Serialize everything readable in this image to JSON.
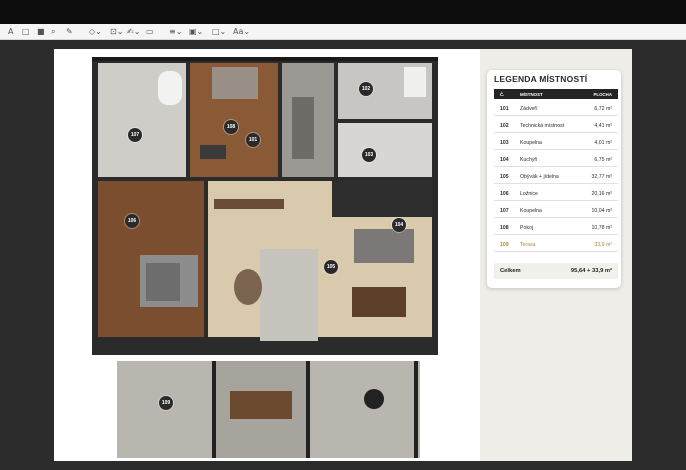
{
  "toolbar": {
    "items": [
      {
        "icon": "text-tool-icon",
        "glyph": "A"
      },
      {
        "icon": "square-icon",
        "glyph": "□"
      },
      {
        "icon": "fill-square-icon",
        "glyph": "■"
      },
      {
        "icon": "search-icon",
        "glyph": "⌕"
      },
      {
        "icon": "pen-icon",
        "glyph": "✎"
      },
      {
        "icon": "shapes-icon",
        "glyph": "◇⌄"
      },
      {
        "icon": "insert-icon",
        "glyph": "⊡⌄"
      },
      {
        "icon": "sign-icon",
        "glyph": "✍⌄"
      },
      {
        "icon": "window-icon",
        "glyph": "▭"
      },
      {
        "icon": "line-style-icon",
        "glyph": "≡⌄"
      },
      {
        "icon": "border-color-icon",
        "glyph": "▣⌄"
      },
      {
        "icon": "fill-color-icon",
        "glyph": "□⌄"
      },
      {
        "icon": "text-style-icon",
        "glyph": "Aa⌄"
      }
    ]
  },
  "legend": {
    "title": "LEGENDA MÍSTNOSTÍ",
    "col_num": "Č.",
    "col_room": "MÍSTNOST",
    "col_area": "PLOCHA",
    "rows": [
      {
        "num": "101",
        "name": "Zádveří",
        "area": "6,72 m²"
      },
      {
        "num": "102",
        "name": "Technická místnost",
        "area": "4,41 m²"
      },
      {
        "num": "103",
        "name": "Koupelna",
        "area": "4,01 m²"
      },
      {
        "num": "104",
        "name": "Kuchyň",
        "area": "6,75 m²"
      },
      {
        "num": "105",
        "name": "Obývák + jídelna",
        "area": "32,77 m²"
      },
      {
        "num": "106",
        "name": "Ložnice",
        "area": "20,16 m²"
      },
      {
        "num": "107",
        "name": "Koupelna",
        "area": "10,04 m²"
      },
      {
        "num": "108",
        "name": "Pokoj",
        "area": "10,78 m²"
      },
      {
        "num": "109",
        "name": "Terasa",
        "area": "33,9 m²"
      }
    ],
    "total_label": "Celkem",
    "total_value": "95,64 + 33,9 m²"
  },
  "plan": {
    "labels": [
      "101",
      "102",
      "103",
      "104",
      "105",
      "106",
      "107",
      "108",
      "109"
    ]
  },
  "colors": {
    "accent": "#b08740",
    "wall": "#2b2b2b",
    "wood": "#8a5a36",
    "floor_light": "#d9c9ad"
  }
}
